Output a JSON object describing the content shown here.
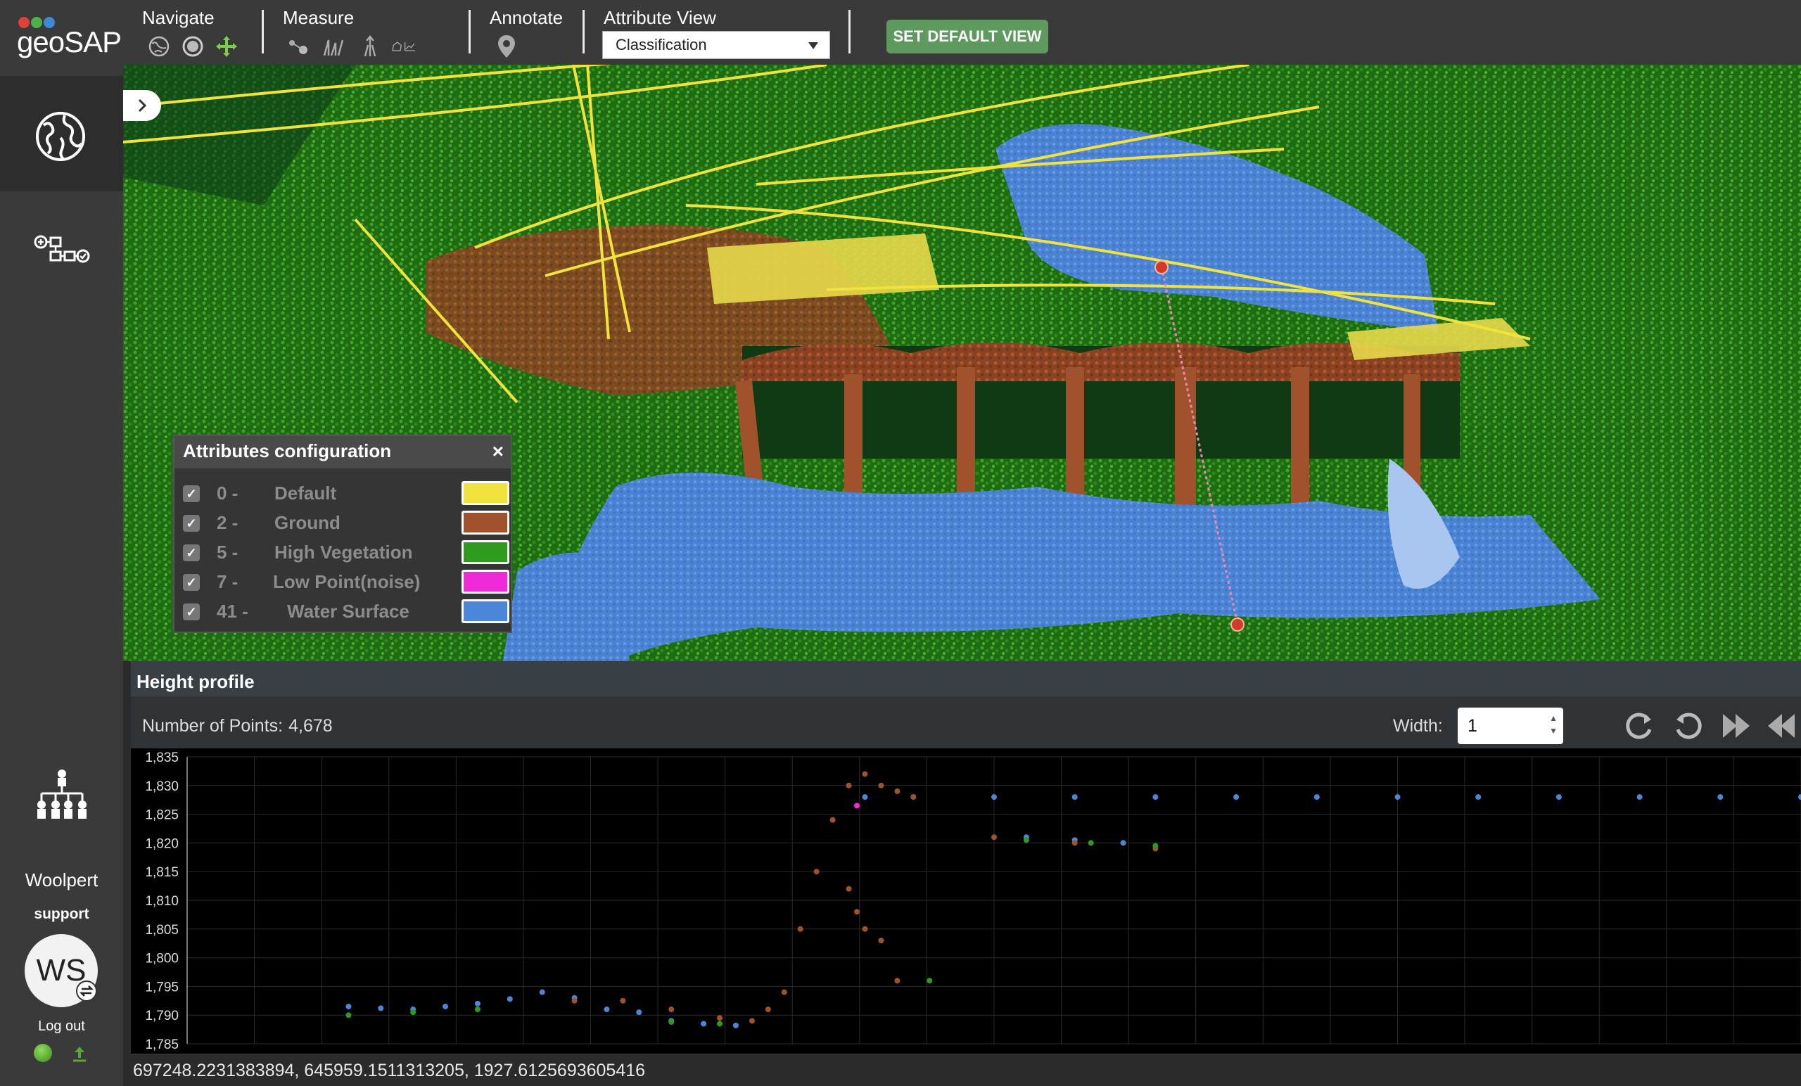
{
  "brand": {
    "name": "geoSAP",
    "dot_colors": [
      "#e0413a",
      "#4fb04a",
      "#3d8bd6"
    ]
  },
  "toolbar": {
    "navigate_label": "Navigate",
    "measure_label": "Measure",
    "annotate_label": "Annotate",
    "attribute_view_label": "Attribute View",
    "attribute_view_value": "Classification",
    "set_default_view_label": "SET DEFAULT VIEW",
    "navigate_tools": [
      "globe-orbit-icon",
      "target-circle-icon",
      "pan-arrows-icon"
    ],
    "measure_tools": [
      "point-measure-icon",
      "distance-icon",
      "height-icon",
      "area-profile-icon"
    ],
    "annotate_tools": [
      "map-pin-icon"
    ]
  },
  "sidebar": {
    "org_name": "Woolpert",
    "user_name": "support",
    "avatar_initials": "WS",
    "logout_label": "Log out"
  },
  "attributes_panel": {
    "title": "Attributes configuration",
    "close_glyph": "×",
    "check_glyph": "✓",
    "items": [
      {
        "code": "0 -",
        "name": "Default",
        "color": "#f2e23c",
        "checked": true
      },
      {
        "code": "2 -",
        "name": "Ground",
        "color": "#a0522d",
        "checked": true
      },
      {
        "code": "5 -",
        "name": "High Vegetation",
        "color": "#2e9a1e",
        "checked": true
      },
      {
        "code": "7 -",
        "name": "Low Point(noise)",
        "color": "#ee2bd6",
        "checked": true
      },
      {
        "code": "41 -",
        "name": "Water Surface",
        "color": "#4b86d8",
        "checked": true
      }
    ]
  },
  "height_profile": {
    "title": "Height profile",
    "num_points_label": "Number of Points:",
    "num_points_value": "4,678",
    "width_label": "Width:",
    "width_value": "1",
    "y_ticks": [
      "1,835",
      "1,830",
      "1,825",
      "1,820",
      "1,815",
      "1,810",
      "1,805",
      "1,800",
      "1,795",
      "1,790",
      "1,785"
    ]
  },
  "status_coordinates": "697248.2231383894, 645959.1511313205, 1927.6125693605416",
  "chart_data": {
    "type": "scatter",
    "title": "",
    "xlabel": "",
    "ylabel": "",
    "ylim": [
      1785,
      1835
    ],
    "y_ticks": [
      1835,
      1830,
      1825,
      1820,
      1815,
      1810,
      1805,
      1800,
      1795,
      1790,
      1785
    ],
    "grid": true,
    "series": [
      {
        "name": "",
        "color": "#4b86d8",
        "x": [
          0.1,
          0.12,
          0.14,
          0.16,
          0.18,
          0.2,
          0.22,
          0.24,
          0.26,
          0.28,
          0.3,
          0.32,
          0.34,
          0.42,
          0.45,
          0.5,
          0.55,
          0.6,
          0.65,
          0.7,
          0.75,
          0.8,
          0.85,
          0.9,
          0.95,
          1.0,
          0.52,
          0.55,
          0.58
        ],
        "y": [
          1791.5,
          1791.2,
          1791.0,
          1791.5,
          1792.0,
          1792.8,
          1794.0,
          1793.0,
          1791.0,
          1790.5,
          1789.0,
          1788.5,
          1788.2,
          1828.0,
          1828.0,
          1828.0,
          1828.0,
          1828.0,
          1828.0,
          1828.0,
          1828.0,
          1828.0,
          1828.0,
          1828.0,
          1828.0,
          1828.0,
          1821.0,
          1820.5,
          1820.0
        ]
      },
      {
        "name": "",
        "color": "#a0522d",
        "x": [
          0.24,
          0.27,
          0.3,
          0.33,
          0.35,
          0.36,
          0.37,
          0.38,
          0.39,
          0.4,
          0.41,
          0.42,
          0.43,
          0.44,
          0.45,
          0.41,
          0.415,
          0.42,
          0.43,
          0.44,
          0.5,
          0.55,
          0.6
        ],
        "y": [
          1792.5,
          1792.5,
          1791.0,
          1789.5,
          1789.0,
          1791.0,
          1794.0,
          1805.0,
          1815.0,
          1824.0,
          1830.0,
          1832.0,
          1830.0,
          1829.0,
          1828.0,
          1812.0,
          1808.0,
          1805.0,
          1803.0,
          1796.0,
          1821.0,
          1820.0,
          1819.0
        ]
      },
      {
        "name": "",
        "color": "#2e9a1e",
        "x": [
          0.1,
          0.14,
          0.18,
          0.3,
          0.33,
          0.46,
          0.52,
          0.56,
          0.6
        ],
        "y": [
          1790.0,
          1790.5,
          1791.0,
          1788.8,
          1788.5,
          1796.0,
          1820.5,
          1820.0,
          1819.5
        ]
      },
      {
        "name": "",
        "color": "#ee2bd6",
        "x": [
          0.415
        ],
        "y": [
          1826.5
        ]
      }
    ]
  }
}
